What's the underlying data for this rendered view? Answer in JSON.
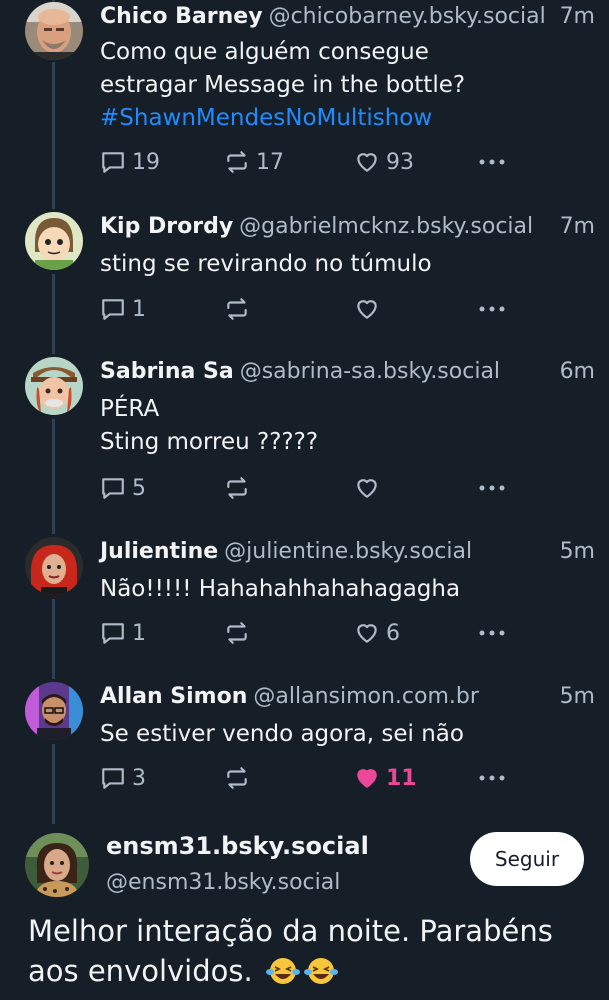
{
  "replies": [
    {
      "name": "Chico Barney",
      "handle": "@chicobarney.bsky.social",
      "time": "7m",
      "lines": [
        "Como que alguém consegue",
        "estragar Message in the bottle?"
      ],
      "hashtag": "#ShawnMendesNoMultishow",
      "reply_count": "19",
      "repost_count": "17",
      "like_count": "93",
      "avatar": "bald-man-avatar"
    },
    {
      "name": "Kip Drordy",
      "handle": "@gabrielmcknz.bsky.social",
      "time": "7m",
      "lines": [
        "sting se revirando no túmulo"
      ],
      "reply_count": "1",
      "repost_count": "",
      "like_count": "",
      "avatar": "cartoon-kid-avatar"
    },
    {
      "name": "Sabrina Sa",
      "handle": "@sabrina-sa.bsky.social",
      "time": "6m",
      "lines": [
        "PÉRA",
        "Sting morreu ?????"
      ],
      "reply_count": "5",
      "repost_count": "",
      "like_count": "",
      "avatar": "cartoon-redhead-avatar"
    },
    {
      "name": "Julientine",
      "handle": "@julientine.bsky.social",
      "time": "5m",
      "lines": [
        "Não!!!!! Hahahahhahahagagha"
      ],
      "reply_count": "1",
      "repost_count": "",
      "like_count": "6",
      "avatar": "red-hair-woman-avatar"
    },
    {
      "name": "Allan Simon",
      "handle": "@allansimon.com.br",
      "time": "5m",
      "lines": [
        "Se estiver vendo agora, sei não"
      ],
      "reply_count": "3",
      "repost_count": "",
      "like_count": "11",
      "liked": true,
      "avatar": "purple-studio-man-avatar"
    }
  ],
  "main_post": {
    "display_name": "ensm31.bsky.social",
    "handle": "@ensm31.bsky.social",
    "follow_label": "Seguir",
    "text": "Melhor interação da noite. Parabéns aos envolvidos.",
    "emoji": "laughing-crying-emoji x2"
  },
  "colors": {
    "background": "#161e27",
    "thread_line": "#2e4052",
    "hashtag": "#208bfe",
    "liked": "#ec4899",
    "muted": "#aebbc9"
  }
}
